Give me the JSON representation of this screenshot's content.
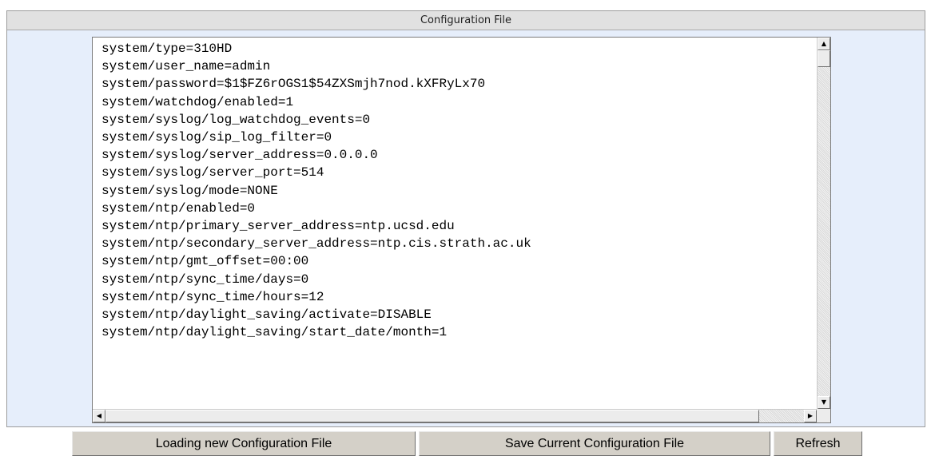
{
  "panel": {
    "title": "Configuration File"
  },
  "editor": {
    "lines": [
      "system/type=310HD",
      "system/user_name=admin",
      "system/password=$1$FZ6rOGS1$54ZXSmjh7nod.kXFRyLx70",
      "system/watchdog/enabled=1",
      "system/syslog/log_watchdog_events=0",
      "system/syslog/sip_log_filter=0",
      "system/syslog/server_address=0.0.0.0",
      "system/syslog/server_port=514",
      "system/syslog/mode=NONE",
      "system/ntp/enabled=0",
      "system/ntp/primary_server_address=ntp.ucsd.edu",
      "system/ntp/secondary_server_address=ntp.cis.strath.ac.uk",
      "system/ntp/gmt_offset=00:00",
      "system/ntp/sync_time/days=0",
      "system/ntp/sync_time/hours=12",
      "system/ntp/daylight_saving/activate=DISABLE",
      "system/ntp/daylight_saving/start_date/month=1"
    ],
    "scroll_up_glyph": "▲",
    "scroll_down_glyph": "▼",
    "scroll_left_glyph": "◀",
    "scroll_right_glyph": "▶"
  },
  "toolbar": {
    "load_label": "Loading new Configuration File",
    "save_label": "Save Current Configuration File",
    "refresh_label": "Refresh"
  }
}
